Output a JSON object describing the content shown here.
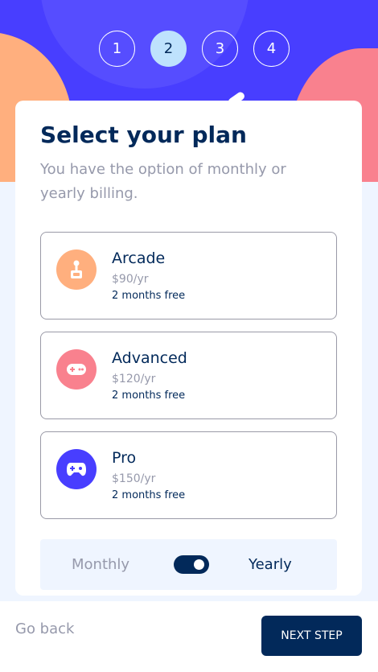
{
  "steps": [
    {
      "label": "1",
      "active": false
    },
    {
      "label": "2",
      "active": true
    },
    {
      "label": "3",
      "active": false
    },
    {
      "label": "4",
      "active": false
    }
  ],
  "header": {
    "title": "Select your plan",
    "subtitle": "You have the option of monthly or yearly billing."
  },
  "plans": [
    {
      "name": "Arcade",
      "price": "$90/yr",
      "bonus": "2 months free",
      "icon": "joystick-icon",
      "color": "#ffaf7e"
    },
    {
      "name": "Advanced",
      "price": "$120/yr",
      "bonus": "2 months free",
      "icon": "gamepad-icon",
      "color": "#f9818e"
    },
    {
      "name": "Pro",
      "price": "$150/yr",
      "bonus": "2 months free",
      "icon": "controller-icon",
      "color": "#483eff"
    }
  ],
  "billing": {
    "monthly_label": "Monthly",
    "yearly_label": "Yearly",
    "selected": "Yearly"
  },
  "footer": {
    "back_label": "Go back",
    "next_label": "NEXT STEP"
  },
  "colors": {
    "primary": "#02295a",
    "accent": "#483eff",
    "muted": "#9699ab",
    "orange": "#ffaf7e",
    "pink": "#f9818e",
    "light_blue": "#bee2fd",
    "background": "#eff5ff"
  }
}
